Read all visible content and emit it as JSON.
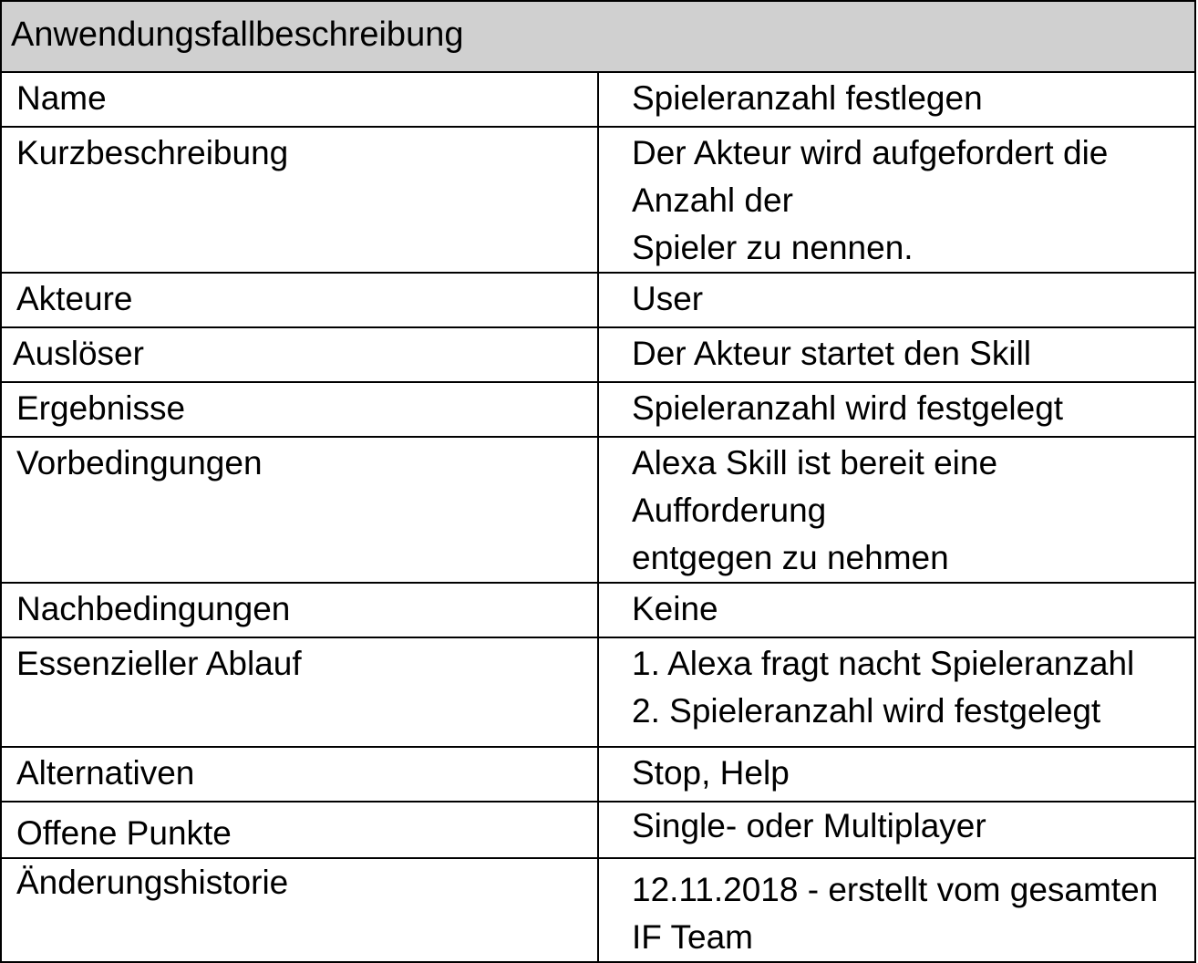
{
  "header": {
    "title": "Anwendungsfallbeschreibung"
  },
  "rows": [
    {
      "label": "Name",
      "value": "Spieleranzahl festlegen"
    },
    {
      "label": "Kurzbeschreibung",
      "lines": [
        "Der Akteur wird aufgefordert die Anzahl der",
        "Spieler zu nennen."
      ]
    },
    {
      "label": "Akteure",
      "value": "User"
    },
    {
      "label": "Auslöser",
      "value": "Der Akteur startet den Skill"
    },
    {
      "label": "Ergebnisse",
      "value": "Spieleranzahl wird festgelegt"
    },
    {
      "label": "Vorbedingungen",
      "lines": [
        "Alexa Skill ist bereit eine Aufforderung",
        "entgegen zu nehmen"
      ]
    },
    {
      "label": "Nachbedingungen",
      "value": "Keine"
    },
    {
      "label": "Essenzieller Ablauf",
      "lines": [
        "1. Alexa fragt nacht Spieleranzahl",
        "2. Spieleranzahl wird festgelegt"
      ]
    },
    {
      "label": "Alternativen",
      "value": "Stop, Help"
    },
    {
      "label": "Offene Punkte",
      "value": "Single- oder Multiplayer"
    },
    {
      "label": "Änderungshistorie",
      "value": "12.11.2018 - erstellt vom gesamten IF Team"
    }
  ]
}
